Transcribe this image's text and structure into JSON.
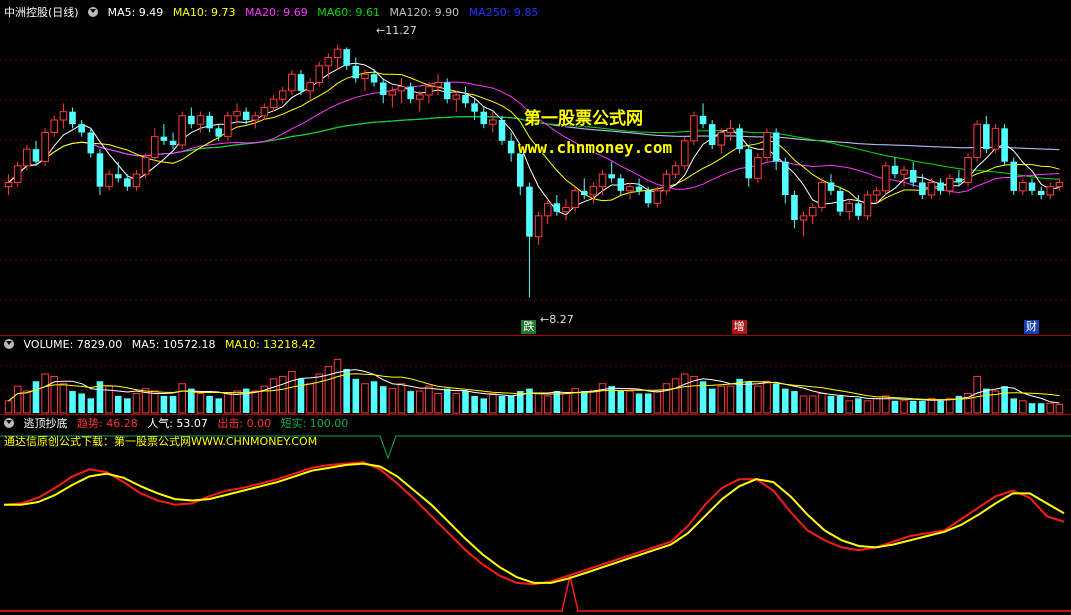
{
  "header_main": {
    "name": "中洲控股(日线)",
    "ma5": "MA5: 9.49",
    "ma10": "MA10: 9.73",
    "ma20": "MA20: 9.69",
    "ma60": "MA60: 9.61",
    "ma120": "MA120: 9.90",
    "ma250": "MA250: 9.85"
  },
  "header_volume": {
    "vol": "VOLUME: 7829.00",
    "ma5": "MA5: 10572.18",
    "ma10": "MA10: 13218.42"
  },
  "header_ind": {
    "name": "逃顶抄底",
    "trend": "趋势: 46.28",
    "pop": "人气: 53.07",
    "out": "出击: 0.00",
    "short": "短实: 100.00"
  },
  "ind_note": "通达信原创公式下载：第一股票公式网WWW.CHNMONEY.COM",
  "watermark": {
    "line1": "第一股票公式网",
    "line2": "www.chnmoney.com"
  },
  "annotations": {
    "high": "11.27",
    "low": "8.27"
  },
  "signals": [
    {
      "label": "跌",
      "bar": 57,
      "color": "#1f7a2f"
    },
    {
      "label": "增",
      "bar": 80,
      "color": "#b01515"
    },
    {
      "label": "财",
      "bar": 112,
      "color": "#1a3fb0"
    }
  ],
  "colors": {
    "up": "#ff3a3a",
    "down": "#54ffff",
    "ma5": "#ffffff",
    "ma10": "#ffff00",
    "ma20": "#ff33ff",
    "ma60": "#00dd00",
    "ma120": "#c0c0c0",
    "ma250": "#2233ff",
    "ind_red": "#ff1a1a",
    "ind_yellow": "#ffff00",
    "ind_green": "#00b050"
  },
  "chart_data": [
    {
      "type": "candlestick",
      "title": "中洲控股(日线)",
      "ylim": [
        8.0,
        11.6
      ],
      "ohlc": [
        [
          9.6,
          9.75,
          9.5,
          9.65
        ],
        [
          9.65,
          9.9,
          9.6,
          9.85
        ],
        [
          9.85,
          10.1,
          9.8,
          10.05
        ],
        [
          10.05,
          10.15,
          9.85,
          9.9
        ],
        [
          9.9,
          10.3,
          9.85,
          10.25
        ],
        [
          10.25,
          10.45,
          10.2,
          10.4
        ],
        [
          10.4,
          10.6,
          10.3,
          10.5
        ],
        [
          10.5,
          10.55,
          10.3,
          10.35
        ],
        [
          10.35,
          10.4,
          10.2,
          10.25
        ],
        [
          10.25,
          10.3,
          9.95,
          10.0
        ],
        [
          10.0,
          10.05,
          9.5,
          9.6
        ],
        [
          9.6,
          9.8,
          9.55,
          9.75
        ],
        [
          9.75,
          9.9,
          9.65,
          9.7
        ],
        [
          9.7,
          9.75,
          9.55,
          9.6
        ],
        [
          9.6,
          9.8,
          9.55,
          9.75
        ],
        [
          9.75,
          10.0,
          9.7,
          9.95
        ],
        [
          9.95,
          10.3,
          9.9,
          10.2
        ],
        [
          10.2,
          10.35,
          10.1,
          10.15
        ],
        [
          10.15,
          10.25,
          10.05,
          10.1
        ],
        [
          10.1,
          10.5,
          10.05,
          10.45
        ],
        [
          10.45,
          10.55,
          10.3,
          10.35
        ],
        [
          10.35,
          10.5,
          10.25,
          10.45
        ],
        [
          10.45,
          10.5,
          10.25,
          10.3
        ],
        [
          10.3,
          10.35,
          10.15,
          10.2
        ],
        [
          10.2,
          10.5,
          10.15,
          10.45
        ],
        [
          10.45,
          10.6,
          10.35,
          10.5
        ],
        [
          10.5,
          10.55,
          10.35,
          10.4
        ],
        [
          10.4,
          10.5,
          10.3,
          10.45
        ],
        [
          10.45,
          10.6,
          10.4,
          10.55
        ],
        [
          10.55,
          10.7,
          10.5,
          10.65
        ],
        [
          10.65,
          10.8,
          10.6,
          10.75
        ],
        [
          10.75,
          11.0,
          10.7,
          10.95
        ],
        [
          10.95,
          11.0,
          10.7,
          10.75
        ],
        [
          10.75,
          10.9,
          10.65,
          10.85
        ],
        [
          10.85,
          11.1,
          10.8,
          11.05
        ],
        [
          11.05,
          11.2,
          10.9,
          11.15
        ],
        [
          11.15,
          11.3,
          11.0,
          11.25
        ],
        [
          11.25,
          11.27,
          11.0,
          11.05
        ],
        [
          11.05,
          11.15,
          10.85,
          10.9
        ],
        [
          10.9,
          11.0,
          10.75,
          10.95
        ],
        [
          10.95,
          11.0,
          10.8,
          10.85
        ],
        [
          10.85,
          10.9,
          10.6,
          10.7
        ],
        [
          10.7,
          10.8,
          10.55,
          10.75
        ],
        [
          10.75,
          10.9,
          10.6,
          10.8
        ],
        [
          10.8,
          10.85,
          10.6,
          10.65
        ],
        [
          10.65,
          10.75,
          10.5,
          10.7
        ],
        [
          10.7,
          10.85,
          10.6,
          10.8
        ],
        [
          10.8,
          10.95,
          10.7,
          10.85
        ],
        [
          10.85,
          10.9,
          10.6,
          10.65
        ],
        [
          10.65,
          10.75,
          10.5,
          10.7
        ],
        [
          10.7,
          10.8,
          10.55,
          10.6
        ],
        [
          10.6,
          10.65,
          10.4,
          10.5
        ],
        [
          10.5,
          10.55,
          10.3,
          10.35
        ],
        [
          10.35,
          10.5,
          10.25,
          10.4
        ],
        [
          10.4,
          10.45,
          10.1,
          10.15
        ],
        [
          10.15,
          10.25,
          9.9,
          10.0
        ],
        [
          10.0,
          10.05,
          9.5,
          9.6
        ],
        [
          9.6,
          9.65,
          8.27,
          9.0
        ],
        [
          9.0,
          9.3,
          8.9,
          9.25
        ],
        [
          9.25,
          9.45,
          9.15,
          9.4
        ],
        [
          9.4,
          9.5,
          9.25,
          9.3
        ],
        [
          9.3,
          9.45,
          9.2,
          9.35
        ],
        [
          9.35,
          9.6,
          9.3,
          9.55
        ],
        [
          9.55,
          9.7,
          9.45,
          9.5
        ],
        [
          9.5,
          9.65,
          9.4,
          9.6
        ],
        [
          9.6,
          9.8,
          9.5,
          9.75
        ],
        [
          9.75,
          9.9,
          9.65,
          9.7
        ],
        [
          9.7,
          9.75,
          9.5,
          9.55
        ],
        [
          9.55,
          9.65,
          9.45,
          9.6
        ],
        [
          9.6,
          9.7,
          9.5,
          9.55
        ],
        [
          9.55,
          9.6,
          9.35,
          9.4
        ],
        [
          9.4,
          9.6,
          9.35,
          9.55
        ],
        [
          9.55,
          9.8,
          9.5,
          9.75
        ],
        [
          9.75,
          9.9,
          9.7,
          9.85
        ],
        [
          9.85,
          10.2,
          9.8,
          10.15
        ],
        [
          10.15,
          10.5,
          10.1,
          10.45
        ],
        [
          10.45,
          10.6,
          10.3,
          10.35
        ],
        [
          10.35,
          10.4,
          10.05,
          10.1
        ],
        [
          10.1,
          10.3,
          10.0,
          10.25
        ],
        [
          10.25,
          10.4,
          10.15,
          10.3
        ],
        [
          10.3,
          10.35,
          10.0,
          10.05
        ],
        [
          10.05,
          10.1,
          9.6,
          9.7
        ],
        [
          9.7,
          10.0,
          9.65,
          9.95
        ],
        [
          9.95,
          10.3,
          9.9,
          10.25
        ],
        [
          10.25,
          10.3,
          9.8,
          9.9
        ],
        [
          9.9,
          9.95,
          9.4,
          9.5
        ],
        [
          9.5,
          9.55,
          9.1,
          9.2
        ],
        [
          9.2,
          9.3,
          9.0,
          9.25
        ],
        [
          9.25,
          9.4,
          9.15,
          9.35
        ],
        [
          9.35,
          9.7,
          9.3,
          9.65
        ],
        [
          9.65,
          9.75,
          9.5,
          9.55
        ],
        [
          9.55,
          9.6,
          9.25,
          9.3
        ],
        [
          9.3,
          9.45,
          9.2,
          9.4
        ],
        [
          9.4,
          9.5,
          9.2,
          9.25
        ],
        [
          9.25,
          9.55,
          9.2,
          9.5
        ],
        [
          9.5,
          9.6,
          9.4,
          9.55
        ],
        [
          9.55,
          9.9,
          9.5,
          9.85
        ],
        [
          9.85,
          9.95,
          9.7,
          9.75
        ],
        [
          9.75,
          9.85,
          9.6,
          9.8
        ],
        [
          9.8,
          9.9,
          9.6,
          9.65
        ],
        [
          9.65,
          9.75,
          9.45,
          9.5
        ],
        [
          9.5,
          9.7,
          9.45,
          9.65
        ],
        [
          9.65,
          9.7,
          9.5,
          9.55
        ],
        [
          9.55,
          9.75,
          9.5,
          9.7
        ],
        [
          9.7,
          9.8,
          9.6,
          9.65
        ],
        [
          9.65,
          10.0,
          9.6,
          9.95
        ],
        [
          9.95,
          10.4,
          9.9,
          10.35
        ],
        [
          10.35,
          10.45,
          10.0,
          10.05
        ],
        [
          10.05,
          10.35,
          10.0,
          10.3
        ],
        [
          10.3,
          10.35,
          9.85,
          9.9
        ],
        [
          9.9,
          9.95,
          9.5,
          9.55
        ],
        [
          9.55,
          9.7,
          9.5,
          9.65
        ],
        [
          9.65,
          9.7,
          9.5,
          9.55
        ],
        [
          9.55,
          9.6,
          9.45,
          9.5
        ],
        [
          9.5,
          9.65,
          9.45,
          9.6
        ],
        [
          9.6,
          9.7,
          9.55,
          9.65
        ]
      ]
    },
    {
      "type": "bar",
      "title": "VOLUME",
      "ylim": [
        0,
        25000
      ],
      "values": [
        5000,
        11000,
        9000,
        13000,
        16000,
        15000,
        12000,
        9000,
        8000,
        6000,
        13000,
        11000,
        7000,
        6000,
        8000,
        10000,
        9000,
        7000,
        7000,
        12000,
        10000,
        8000,
        7000,
        6000,
        8000,
        9000,
        10000,
        9000,
        11000,
        14000,
        15000,
        17000,
        14000,
        12000,
        16000,
        19000,
        22000,
        18000,
        14000,
        12000,
        13000,
        11000,
        10000,
        12000,
        9000,
        9000,
        11000,
        8000,
        10000,
        8000,
        9000,
        7000,
        6000,
        8000,
        7000,
        7000,
        9000,
        10000,
        8000,
        7000,
        9000,
        8000,
        10000,
        9000,
        9000,
        12000,
        11000,
        9000,
        9000,
        8000,
        8000,
        9000,
        12000,
        14000,
        16000,
        15000,
        13000,
        10000,
        11000,
        11000,
        14000,
        13000,
        11000,
        13000,
        12000,
        10000,
        9000,
        7000,
        7000,
        8000,
        7000,
        7000,
        5000,
        6000,
        5000,
        6000,
        7000,
        5000,
        5000,
        5000,
        5000,
        6000,
        5000,
        6000,
        7000,
        8000,
        15000,
        10000,
        9000,
        11000,
        6000,
        5000,
        4000,
        4000,
        4000,
        3500
      ]
    },
    {
      "type": "line",
      "title": "逃顶抄底",
      "ylim": [
        0,
        100
      ],
      "series": [
        {
          "name": "趋势",
          "values": [
            60,
            61,
            65,
            72,
            80,
            85,
            83,
            76,
            68,
            63,
            60,
            61,
            66,
            70,
            72,
            75,
            78,
            82,
            86,
            88,
            89,
            90,
            85,
            75,
            64,
            52,
            40,
            28,
            18,
            10,
            5,
            4,
            6,
            10,
            14,
            18,
            22,
            26,
            30,
            34,
            45,
            60,
            72,
            78,
            78,
            70,
            55,
            42,
            35,
            30,
            28,
            30,
            34,
            38,
            40,
            42,
            50,
            58,
            66,
            70,
            65,
            52,
            48
          ]
        },
        {
          "name": "人气",
          "values": [
            60,
            60,
            62,
            67,
            74,
            80,
            82,
            79,
            73,
            68,
            64,
            63,
            64,
            67,
            70,
            73,
            76,
            80,
            84,
            86,
            88,
            89,
            87,
            80,
            70,
            60,
            48,
            36,
            25,
            16,
            9,
            5,
            5,
            8,
            12,
            16,
            20,
            24,
            28,
            32,
            40,
            52,
            64,
            73,
            78,
            76,
            66,
            53,
            42,
            35,
            31,
            30,
            32,
            35,
            38,
            41,
            46,
            53,
            61,
            68,
            68,
            61,
            54
          ]
        }
      ]
    }
  ]
}
